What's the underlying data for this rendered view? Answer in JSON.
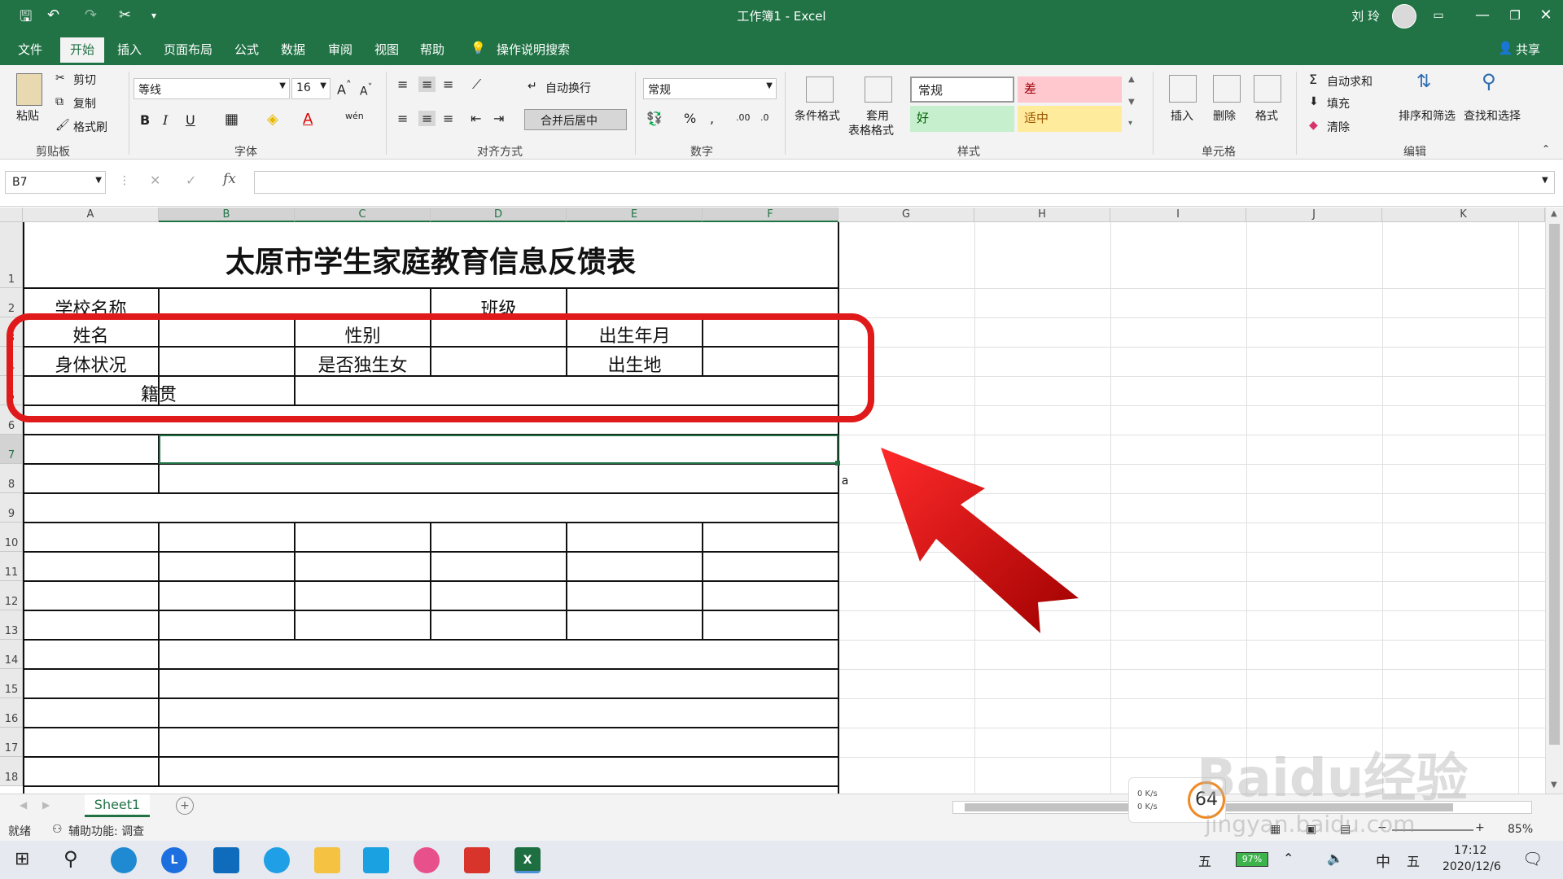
{
  "window": {
    "title": "工作簿1  -  Excel",
    "user": "刘 玲"
  },
  "tabs": [
    "文件",
    "开始",
    "插入",
    "页面布局",
    "公式",
    "数据",
    "审阅",
    "视图",
    "帮助",
    "操作说明搜索"
  ],
  "share_label": "共享",
  "ribbon": {
    "clipboard": {
      "paste": "粘贴",
      "cut": "剪切",
      "copy": "复制",
      "format_painter": "格式刷",
      "label": "剪贴板"
    },
    "font": {
      "name": "等线",
      "size": "16",
      "bold": "B",
      "italic": "I",
      "underline": "U",
      "phonetic": "wén",
      "label": "字体"
    },
    "alignment": {
      "wrap": "自动换行",
      "merge": "合并后居中",
      "label": "对齐方式"
    },
    "number": {
      "format": "常规",
      "label": "数字"
    },
    "styles": {
      "conditional": "条件格式",
      "table_format_1": "套用",
      "table_format_2": "表格格式",
      "normal": "常规",
      "bad": "差",
      "good": "好",
      "neutral": "适中",
      "label": "样式"
    },
    "cells": {
      "insert": "插入",
      "delete": "删除",
      "format": "格式",
      "label": "单元格"
    },
    "editing": {
      "autosum": "自动求和",
      "fill": "填充",
      "clear": "清除",
      "sort": "排序和筛选",
      "find": "查找和选择",
      "label": "编辑"
    }
  },
  "formula_bar": {
    "name_box": "B7",
    "fx": "fx",
    "value": ""
  },
  "columns": [
    "A",
    "B",
    "C",
    "D",
    "E",
    "F",
    "G",
    "H",
    "I",
    "J",
    "K"
  ],
  "rows": [
    "1",
    "2",
    "3",
    "4",
    "5",
    "6",
    "7",
    "8",
    "9",
    "10",
    "11",
    "12",
    "13",
    "14",
    "15",
    "16",
    "17",
    "18"
  ],
  "cells": {
    "title": "太原市学生家庭教育信息反馈表",
    "school_name": "学校名称",
    "class": "班级",
    "name": "姓名",
    "gender": "性别",
    "birth_month": "出生年月",
    "health": "身体状况",
    "only_child": "是否独生女",
    "birthplace": "出生地",
    "native_place": "籍贯",
    "stray": "a"
  },
  "sheet_tabs": [
    "Sheet1"
  ],
  "status": {
    "ready": "就绪",
    "accessibility": "辅助功能: 调查",
    "zoom": "85%"
  },
  "taskbar": {
    "time": "17:12",
    "date": "2020/12/6",
    "ime": "中",
    "ime2": "五",
    "battery": "97%"
  },
  "overlay": {
    "speed_up": "0 K/s",
    "speed_down": "0 K/s",
    "percent": "64",
    "watermark": "Baidu经验",
    "watermark_url": "jingyan.baidu.com"
  }
}
